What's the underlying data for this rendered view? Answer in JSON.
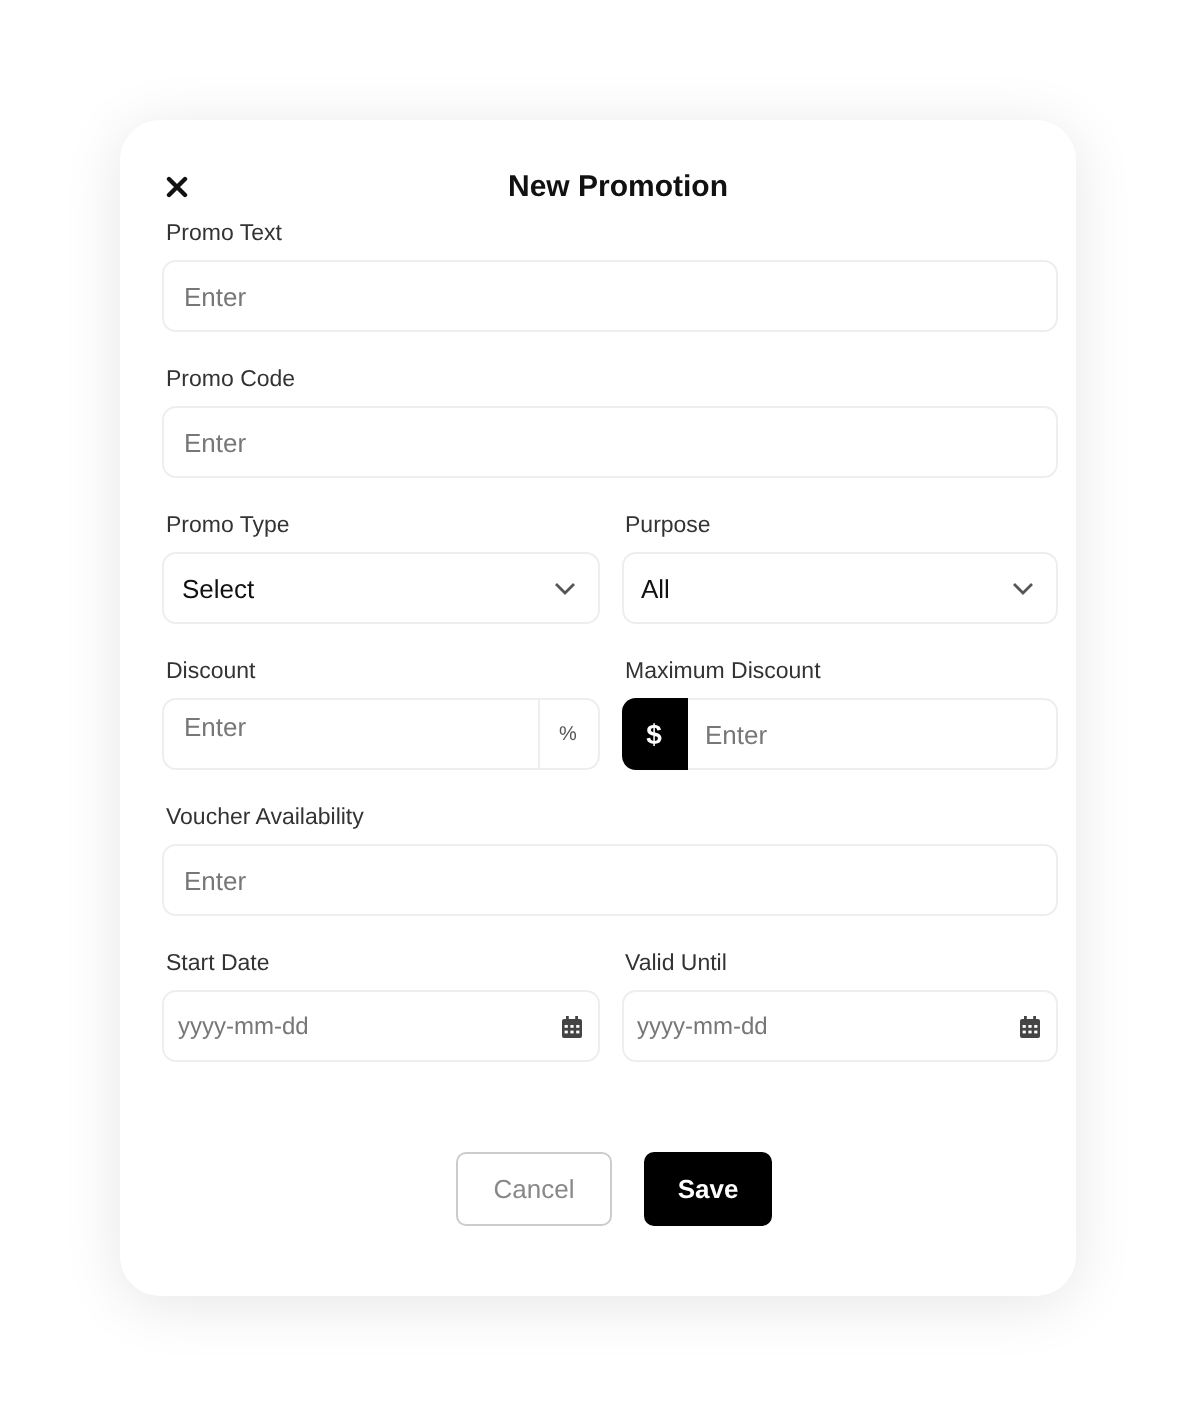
{
  "dialog": {
    "title": "New Promotion"
  },
  "rows": [
    [
      {
        "label": "Promo Text",
        "kind": "text",
        "placeholder": "Enter"
      }
    ],
    [
      {
        "label": "Promo Code",
        "kind": "text",
        "placeholder": "Enter"
      }
    ],
    [
      {
        "label": "Promo Type",
        "kind": "select",
        "value": "Select"
      },
      {
        "label": "Purpose",
        "kind": "select",
        "value": "All"
      }
    ],
    [
      {
        "label": "Discount",
        "kind": "suffix",
        "placeholder": "Enter",
        "affix": "%"
      },
      {
        "label": "Maximum Discount",
        "kind": "prefix",
        "placeholder": "Enter",
        "affix": "$"
      }
    ],
    [
      {
        "label": "Voucher Availability",
        "kind": "text",
        "placeholder": "Enter"
      }
    ],
    [
      {
        "label": "Start Date",
        "kind": "date",
        "placeholder": "yyyy-mm-dd"
      },
      {
        "label": "Valid Until",
        "kind": "date",
        "placeholder": "yyyy-mm-dd"
      }
    ]
  ],
  "buttons": [
    {
      "label": "Cancel",
      "kind": "secondary"
    },
    {
      "label": "Save",
      "kind": "primary"
    }
  ]
}
